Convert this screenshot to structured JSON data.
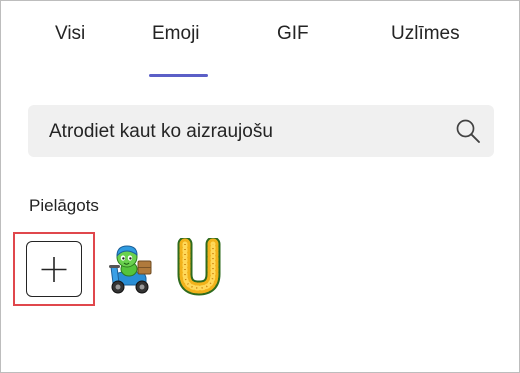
{
  "tabs": [
    {
      "label": "Visi",
      "selected": false
    },
    {
      "label": "Emoji",
      "selected": true
    },
    {
      "label": "GIF",
      "selected": false
    },
    {
      "label": "Uzlīmes",
      "selected": false
    }
  ],
  "search": {
    "value": "Atrodiet kaut ko aizraujošu",
    "icon": "search-icon"
  },
  "section": {
    "label": "Pielāgots"
  },
  "custom_items": [
    {
      "icon": "plus-icon",
      "kind": "add-button",
      "highlighted": true
    },
    {
      "icon": "green-character-on-blue-scooter-emoji"
    },
    {
      "icon": "golden-flower-letter-u-emoji"
    }
  ],
  "colors": {
    "accent": "#5b5fc7",
    "highlight": "#e0474c",
    "search_bg": "#f0f0f0"
  }
}
